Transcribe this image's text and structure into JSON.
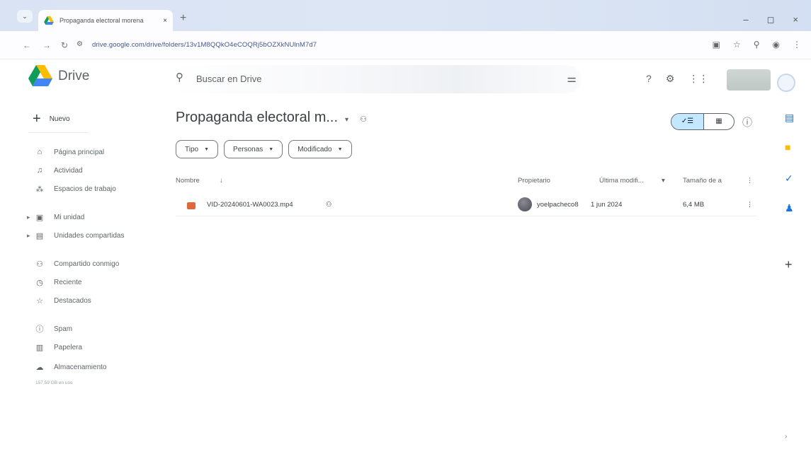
{
  "browser": {
    "tab_title": "Propaganda electoral morena",
    "tab_close": "×",
    "new_tab": "+",
    "url": "drive.google.com/drive/folders/13v1M8QQkO4eCOQRj5bOZXkNUlnM7d7",
    "win_min": "–",
    "win_max": "◻",
    "win_close": "×"
  },
  "header": {
    "brand": "Drive",
    "search_placeholder": "Buscar en Drive"
  },
  "sidebar": {
    "new_label": "Nuevo",
    "items": [
      {
        "label": "Página principal",
        "icon": "home-icon"
      },
      {
        "label": "Actividad",
        "icon": "bell-icon"
      },
      {
        "label": "Espacios de trabajo",
        "icon": "workspaces-icon"
      },
      {
        "label": "Mi unidad",
        "icon": "my-drive-icon"
      },
      {
        "label": "Unidades compartidas",
        "icon": "shared-drives-icon"
      },
      {
        "label": "Compartido conmigo",
        "icon": "people-icon"
      },
      {
        "label": "Reciente",
        "icon": "clock-icon"
      },
      {
        "label": "Destacados",
        "icon": "star-icon"
      },
      {
        "label": "Spam",
        "icon": "spam-icon"
      },
      {
        "label": "Papelera",
        "icon": "trash-icon"
      },
      {
        "label": "Almacenamiento",
        "icon": "cloud-icon"
      }
    ],
    "storage_text": "157,59 GB en uso"
  },
  "main": {
    "folder_title": "Propaganda electoral m...",
    "filters": [
      "Tipo",
      "Personas",
      "Modificado"
    ],
    "columns": {
      "name": "Nombre",
      "owner": "Propietario",
      "modified": "Última modifi...",
      "size": "Tamaño de a"
    },
    "files": [
      {
        "name": "VID-20240601-WA0023.mp4",
        "owner": "yoelpacheco8",
        "modified": "1 jun 2024",
        "size": "6,4 MB"
      }
    ]
  },
  "colors": {
    "accent": "#c2e7ff",
    "video_icon": "#e0693c"
  }
}
